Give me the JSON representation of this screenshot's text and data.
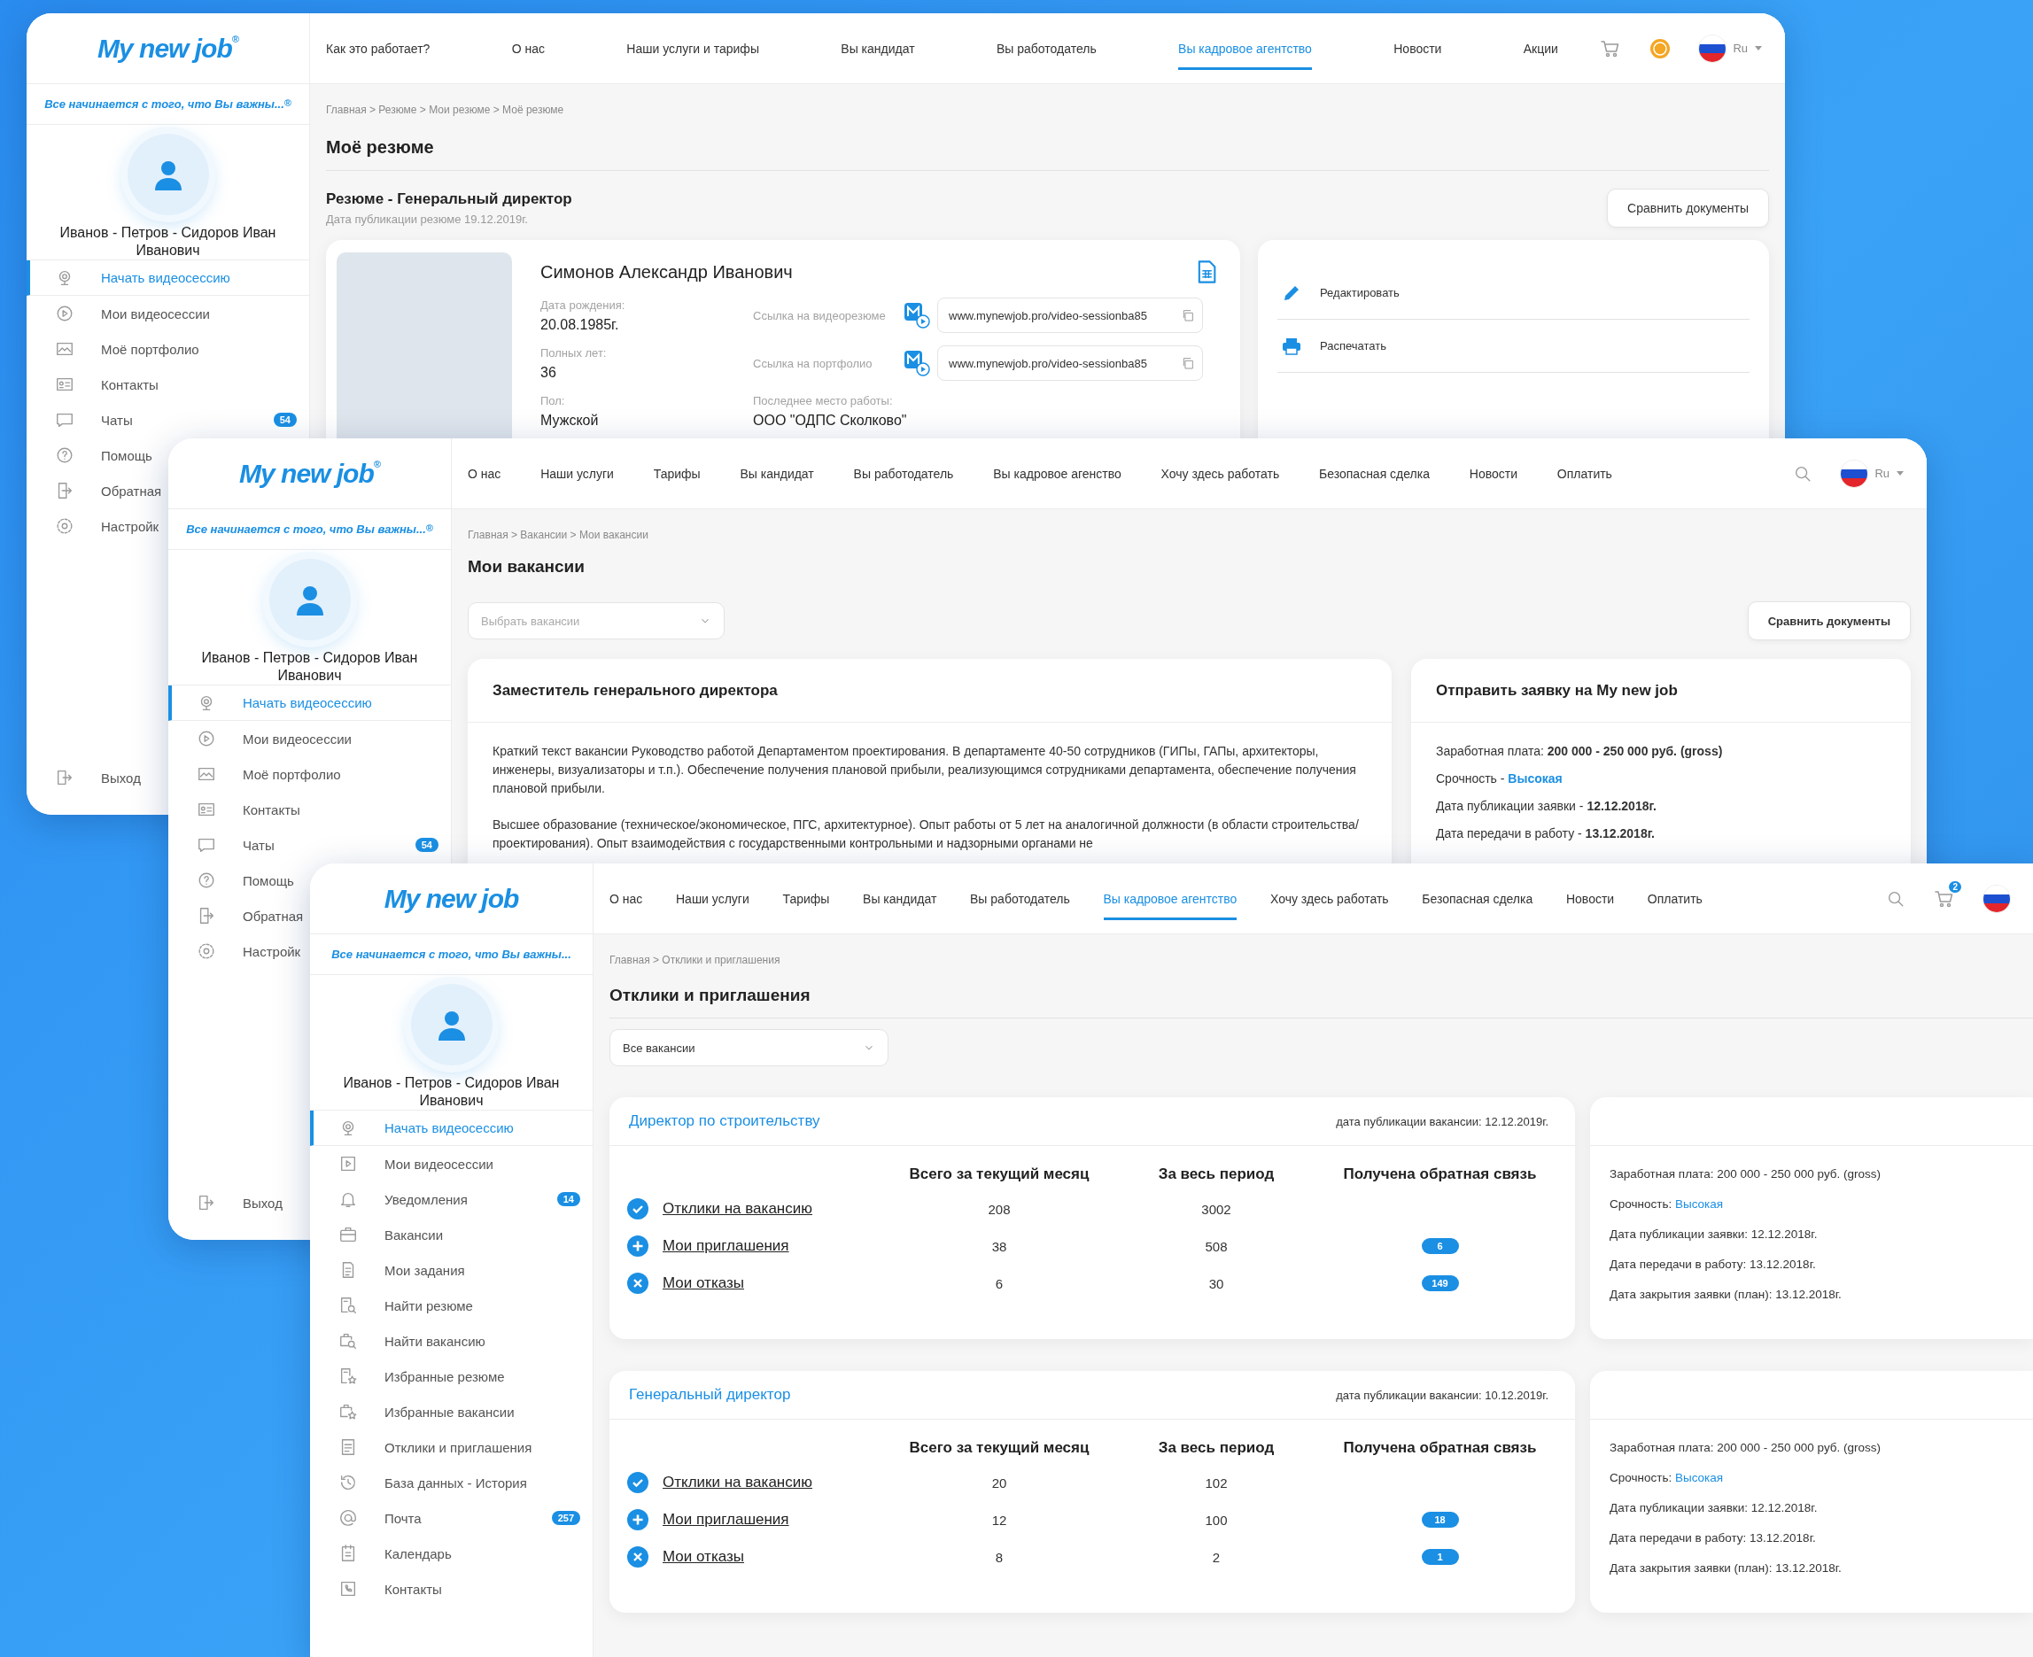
{
  "windows": [
    {
      "kind": "resume",
      "sidebar": {
        "logo": "My new job$^{®}$",
        "slogan": "Все начинается с того, что Вы важны...$^{®}$",
        "user_name": "Иванов - Петров - Сидоров Иван Иванович",
        "menu": [
          {
            "label": "Начать видеосессию",
            "selected": true
          },
          {
            "label": "Мои видеосессии",
            "selected": false
          },
          {
            "label": "Моё портфолио",
            "selected": false
          },
          {
            "label": "Контакты",
            "selected": false
          },
          {
            "label": "Чаты",
            "selected": false,
            "badge": "54"
          },
          {
            "label": "Помощь",
            "selected": false
          },
          {
            "label": "Обратная",
            "selected": false
          },
          {
            "label": "Настройк",
            "selected": false
          }
        ],
        "logout": "Выход"
      },
      "header": {
        "nav": [
          {
            "label": "Как это работает?",
            "selected": false
          },
          {
            "label": "О нас",
            "selected": false
          },
          {
            "label": "Наши услуги и тарифы",
            "selected": false
          },
          {
            "label": "Вы кандидат",
            "selected": false
          },
          {
            "label": "Вы работодатель",
            "selected": false
          },
          {
            "label": "Вы кадровое агентство",
            "selected": true
          },
          {
            "label": "Новости",
            "selected": false
          },
          {
            "label": "Акции",
            "selected": false
          }
        ],
        "language": "Ru"
      },
      "breadcrumb": "Главная > Резюме > Мои резюме > Моё резюме",
      "title": "Моё резюме",
      "resume": {
        "heading": "Резюме - Генеральный директор",
        "published": "Дата публикации резюме 19.12.2019г.",
        "compare_button": "Сравнить документы",
        "name": "Симонов Александр Иванович",
        "fields": [
          {
            "label": "Дата рождения:",
            "value": "20.08.1985г."
          },
          {
            "label": "Полных лет:",
            "value": "36"
          },
          {
            "label": "Пол:",
            "value": "Мужской"
          }
        ],
        "links": [
          {
            "label": "Ссылка на видеорезюме",
            "url": "www.mynewjob.pro/video-sessionba85"
          },
          {
            "label": "Ссылка на портфолио",
            "url": "www.mynewjob.pro/video-sessionba85"
          }
        ],
        "last_job": {
          "label": "Последнее место работы:",
          "value": "ООО \"ОДПС Сколково\""
        },
        "actions": [
          "Редактировать",
          "Распечатать"
        ]
      }
    },
    {
      "kind": "vacancies",
      "sidebar": {
        "logo": "My new job$^{®}$",
        "slogan": "Все начинается с того, что Вы важны...$^{®}$",
        "user_name": "Иванов - Петров - Сидоров Иван Иванович",
        "menu": [
          {
            "label": "Начать видеосессию",
            "selected": true
          },
          {
            "label": "Мои видеосессии",
            "selected": false
          },
          {
            "label": "Моё портфолио",
            "selected": false
          },
          {
            "label": "Контакты",
            "selected": false
          },
          {
            "label": "Чаты",
            "selected": false,
            "badge": "54"
          },
          {
            "label": "Помощь",
            "selected": false
          },
          {
            "label": "Обратная",
            "selected": false
          },
          {
            "label": "Настройк",
            "selected": false
          }
        ],
        "logout": "Выход"
      },
      "header": {
        "nav": [
          {
            "label": "О нас",
            "selected": false
          },
          {
            "label": "Наши услуги",
            "selected": false
          },
          {
            "label": "Тарифы",
            "selected": false
          },
          {
            "label": "Вы кандидат",
            "selected": false
          },
          {
            "label": "Вы работодатель",
            "selected": false
          },
          {
            "label": "Вы кадровое агенство",
            "selected": false
          },
          {
            "label": "Хочу здесь работать",
            "selected": false
          },
          {
            "label": "Безопасная сделка",
            "selected": false
          },
          {
            "label": "Новости",
            "selected": false
          },
          {
            "label": "Оплатить",
            "selected": false
          }
        ],
        "language": "Ru"
      },
      "breadcrumb": "Главная > Вакансии > Мои вакансии",
      "title": "Мои вакансии",
      "select_placeholder": "Выбрать вакансии",
      "compare_button": "Сравнить документы",
      "vacancy": {
        "title": "Заместитель генерального директора",
        "paragraphs": [
          "Краткий текст вакансии Руководство работой Департаментом проектирования. В департаменте 40-50 сотрудников (ГИПы, ГАПы, архитекторы, инженеры, визуализаторы и т.п.). Обеспечение получения плановой прибыли, реализующимся сотрудниками департамента,  обеспечение получения плановой прибыли.",
          "Высшее образование (техническое/экономическое, ПГС, архитектурное). Опыт работы от 5 лет на аналогичной должности (в области строительства/проектирования). Опыт взаимодействия с государственными контрольными и надзорными органами не"
        ]
      },
      "request": {
        "title": "Отправить заявку на My new job",
        "lines": [
          {
            "text": "Заработная плата: **200 000 - 250 000 руб. (gross)**"
          },
          {
            "text": "Срочность - ",
            "accent": "**Высокая**"
          },
          {
            "text": "Дата публикации заявки - **12.12.2018г.**"
          },
          {
            "text": "Дата передачи в работу - **13.12.2018г.**"
          }
        ]
      }
    },
    {
      "kind": "responses",
      "sidebar": {
        "logo": "My new job",
        "slogan": "Все начинается с того, что Вы важны...",
        "user_name": "Иванов - Петров - Сидоров Иван Иванович",
        "menu": [
          {
            "label": "Начать видеосессию",
            "selected": true
          },
          {
            "label": "Мои видеосессии",
            "selected": false
          },
          {
            "label": "Уведомления",
            "selected": false,
            "badge": "14"
          },
          {
            "label": "Вакансии",
            "selected": false
          },
          {
            "label": "Мои задания",
            "selected": false
          },
          {
            "label": "Найти резюме",
            "selected": false
          },
          {
            "label": "Найти вакансию",
            "selected": false
          },
          {
            "label": "Избранные резюме",
            "selected": false
          },
          {
            "label": "Избранные вакансии",
            "selected": false
          },
          {
            "label": "Отклики и приглашения",
            "selected": false
          },
          {
            "label": "База данных - История",
            "selected": false
          },
          {
            "label": "Почта",
            "selected": false,
            "badge": "257"
          },
          {
            "label": "Календарь",
            "selected": false
          },
          {
            "label": "Контакты",
            "selected": false
          }
        ]
      },
      "header": {
        "nav": [
          {
            "label": "О нас",
            "selected": false
          },
          {
            "label": "Наши услуги",
            "selected": false
          },
          {
            "label": "Тарифы",
            "selected": false
          },
          {
            "label": "Вы кандидат",
            "selected": false
          },
          {
            "label": "Вы работодатель",
            "selected": false
          },
          {
            "label": "Вы кадровое агентство",
            "selected": true
          },
          {
            "label": "Хочу здесь работать",
            "selected": false
          },
          {
            "label": "Безопасная сделка",
            "selected": false
          },
          {
            "label": "Новости",
            "selected": false
          },
          {
            "label": "Оплатить",
            "selected": false
          }
        ],
        "cart_badge": "2"
      },
      "breadcrumb": "Главная > Отклики и приглашения",
      "title": "Отклики и приглашения",
      "filter_value": "Все вакансии",
      "vacancies": [
        {
          "title": "Директор по строительству",
          "published": "дата публикации вакансии: 12.12.2019г.",
          "columns": [
            "Всего за текущий месяц",
            "За весь период",
            "Получена обратная связь"
          ],
          "rows": [
            {
              "kind": "responses",
              "label": "Отклики на вакансию",
              "month": "208",
              "total": "3002"
            },
            {
              "kind": "invitations",
              "label": "Мои приглашения",
              "month": "38",
              "total": "508",
              "feedback": "6"
            },
            {
              "kind": "rejections",
              "label": "Мои отказы",
              "month": "6",
              "total": "30",
              "feedback": "149"
            }
          ],
          "info": [
            {
              "text": "Заработная плата: 200 000 - 250 000 руб. (gross)"
            },
            {
              "text": "Срочность: ",
              "accent": "Высокая"
            },
            {
              "text": "Дата публикации заявки: 12.12.2018г."
            },
            {
              "text": "Дата передачи в работу: 13.12.2018г."
            },
            {
              "text": "Дата закрытия заявки (план): 13.12.2018г."
            }
          ]
        },
        {
          "title": "Генеральный директор",
          "published": "дата публикации вакансии: 10.12.2019г.",
          "columns": [
            "Всего за текущий месяц",
            "За весь период",
            "Получена обратная связь"
          ],
          "rows": [
            {
              "kind": "responses",
              "label": "Отклики на вакансию",
              "month": "20",
              "total": "102"
            },
            {
              "kind": "invitations",
              "label": "Мои приглашения",
              "month": "12",
              "total": "100",
              "feedback": "18"
            },
            {
              "kind": "rejections",
              "label": "Мои отказы",
              "month": "8",
              "total": "2",
              "feedback": "1"
            }
          ],
          "info": [
            {
              "text": "Заработная плата: 200 000 - 250 000 руб. (gross)"
            },
            {
              "text": "Срочность: ",
              "accent": "Высокая"
            },
            {
              "text": "Дата публикации заявки: 12.12.2018г."
            },
            {
              "text": "Дата передачи в работу: 13.12.2018г."
            },
            {
              "text": "Дата закрытия заявки (план): 13.12.2018г."
            }
          ]
        }
      ]
    }
  ]
}
